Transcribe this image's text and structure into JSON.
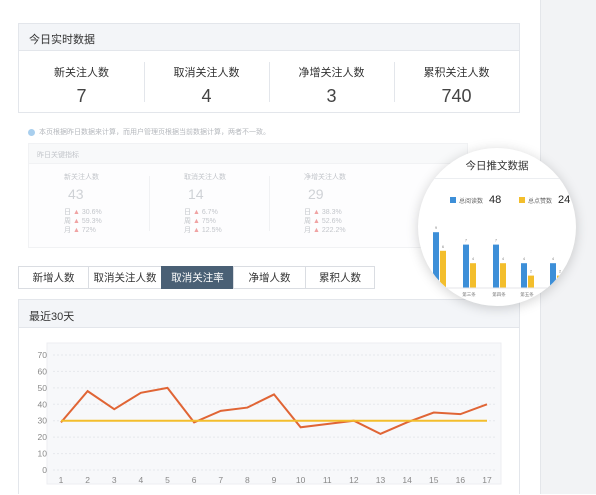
{
  "realtime": {
    "title": "今日实时数据",
    "stats": [
      {
        "label": "新关注人数",
        "value": "7"
      },
      {
        "label": "取消关注人数",
        "value": "4"
      },
      {
        "label": "净增关注人数",
        "value": "3"
      },
      {
        "label": "累积关注人数",
        "value": "740"
      }
    ]
  },
  "notice": "本页根据昨日数据来计算，而用户管理页根据当前数据计算，两者不一致。",
  "yesterday": {
    "title": "昨日关键指标",
    "labels": [
      "日",
      "周",
      "月"
    ],
    "cols": [
      {
        "label": "新关注人数",
        "value": "43",
        "deltas": [
          "30.6%",
          "59.3%",
          "72%"
        ]
      },
      {
        "label": "取消关注人数",
        "value": "14",
        "deltas": [
          "6.7%",
          "75%",
          "12.5%"
        ]
      },
      {
        "label": "净增关注人数",
        "value": "29",
        "deltas": [
          "38.3%",
          "52.6%",
          "222.2%"
        ]
      }
    ]
  },
  "tabs": [
    {
      "label": "新增人数"
    },
    {
      "label": "取消关注人数"
    },
    {
      "label": "取消关注率"
    },
    {
      "label": "净增人数"
    },
    {
      "label": "累积人数"
    }
  ],
  "active_tab": "取消关注率",
  "trend": {
    "title": "最近30天"
  },
  "popup": {
    "title": "今日推文数据",
    "legend": [
      {
        "name": "总阅读数",
        "value": "48",
        "color": "#3d8fd8"
      },
      {
        "name": "总点赞数",
        "value": "24",
        "color": "#f3be2c"
      }
    ],
    "bar_values": [
      {
        "category": "第二条",
        "read": 9,
        "like": 6
      },
      {
        "category": "第三条",
        "read": 7,
        "like": 4
      },
      {
        "category": "第四条",
        "read": 7,
        "like": 4
      },
      {
        "category": "第五条",
        "read": 4,
        "like": 2
      },
      {
        "category": "第六条",
        "read": 4,
        "like": 2
      }
    ],
    "bar_labels": [
      "9",
      "6",
      "7",
      "4",
      "7",
      "4",
      "4",
      "2",
      "4",
      "2"
    ]
  },
  "chart_data": {
    "type": "line",
    "x": [
      1,
      2,
      3,
      4,
      5,
      6,
      7,
      8,
      9,
      10,
      11,
      12,
      13,
      14,
      15,
      16,
      17
    ],
    "series": [
      {
        "values": [
          29,
          48,
          37,
          47,
          50,
          29,
          36,
          38,
          46,
          26,
          28,
          30,
          22,
          29,
          35,
          34,
          40
        ],
        "color": "#e06535"
      },
      {
        "values": [
          30,
          30,
          30,
          30,
          30,
          30,
          30,
          30,
          30,
          30,
          30,
          30,
          30,
          30,
          30,
          30,
          30
        ],
        "color": "#f3be2c"
      }
    ],
    "ylim": [
      0,
      70
    ],
    "yticks": [
      0,
      10,
      20,
      30,
      40,
      50,
      60,
      70
    ],
    "grid": true
  }
}
